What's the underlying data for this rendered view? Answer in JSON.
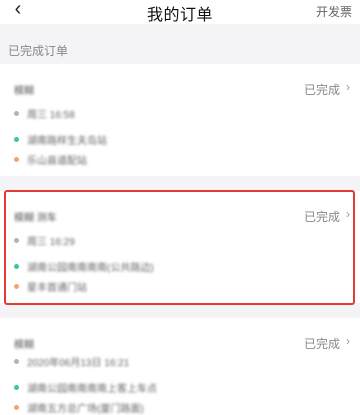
{
  "navbar": {
    "back_icon": "chevron-left-icon",
    "back_glyph": "‹",
    "title": "我的订单",
    "action": "开发票"
  },
  "section_label": "已完成订单",
  "orders": [
    {
      "name": "模糊",
      "status": "已完成",
      "chevron": "›",
      "time": "周三 16:58",
      "from": "湖南路样生夫岛站",
      "to": "乐山县道配站"
    },
    {
      "name": "模糊 测车",
      "status": "已完成",
      "chevron": "›",
      "time": "周三 16:29",
      "from": "湖南公园南南南南(公共路边)",
      "to": "星丰首通门站"
    },
    {
      "name": "模糊",
      "status": "已完成",
      "chevron": "›",
      "time": "2020年06月13日 16:21",
      "from": "湖南公园南南南南上客上车点",
      "to": "湖南五方总广场(厦门路面)"
    }
  ],
  "colors": {
    "highlight_border": "#e53935",
    "origin_dot": "#3cc79a",
    "destination_dot": "#f7a072",
    "time_dot": "#b3b3b3"
  }
}
